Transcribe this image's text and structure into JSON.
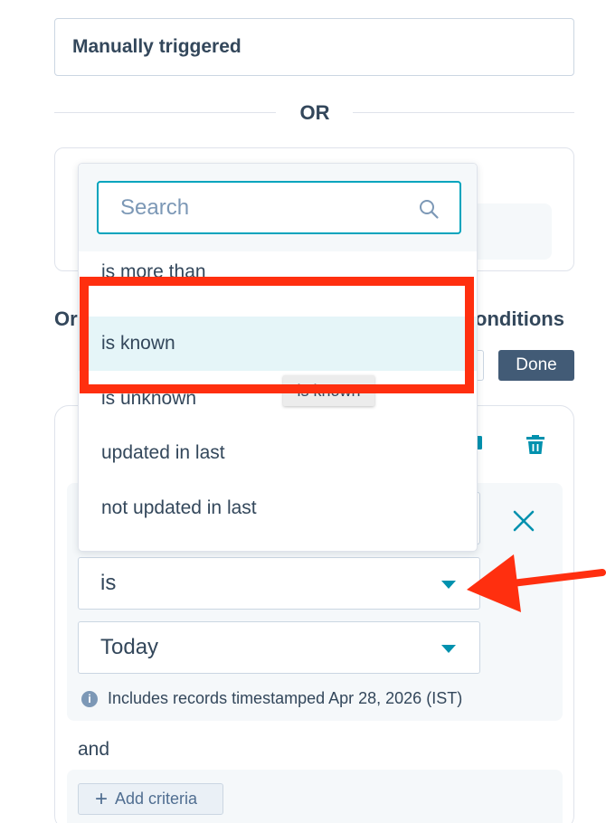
{
  "trigger": {
    "label": "Manually triggered"
  },
  "separator": {
    "label": "OR"
  },
  "section": {
    "left_text": "Or",
    "right_text": "onditions"
  },
  "actions": {
    "done_label": "Done"
  },
  "criteria": {
    "operator_value": "is",
    "date_value": "Today",
    "info_text": "Includes records timestamped Apr 28, 2026 (IST)",
    "and_label": "and",
    "add_criteria_label": "Add criteria"
  },
  "dropdown": {
    "search_placeholder": "Search",
    "options": [
      {
        "label": "is more than"
      },
      {
        "label": "is known"
      },
      {
        "label": "is unknown"
      },
      {
        "label": "updated in last"
      },
      {
        "label": "not updated in last"
      }
    ],
    "tooltip": "is known"
  },
  "colors": {
    "accent": "#0091ae",
    "focus_border": "#00a4bd",
    "done_button_bg": "#425b76",
    "highlight_bg": "#e5f5f8",
    "annotation_red": "#ff2f0f"
  },
  "icons": {
    "search": "search-icon",
    "clone": "clone-icon",
    "delete": "trash-icon",
    "close": "close-icon",
    "info": "info-icon",
    "caret": "caret-down-icon",
    "add": "plus-icon"
  }
}
